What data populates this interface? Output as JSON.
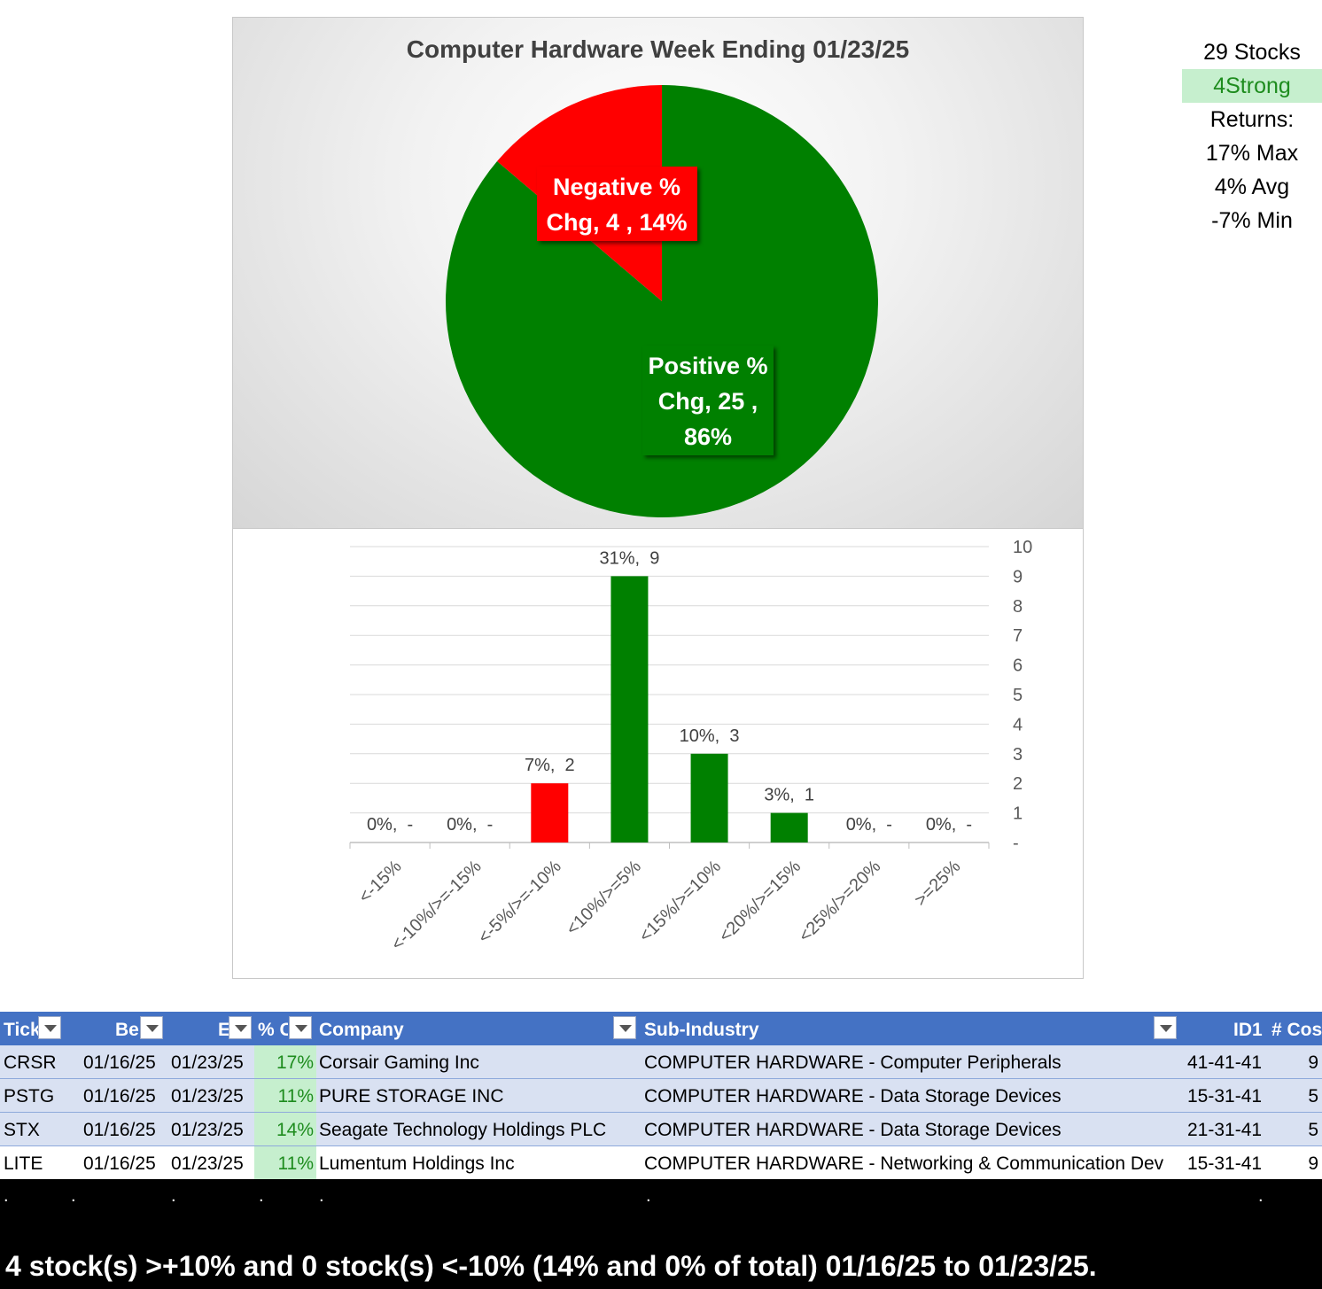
{
  "chart_data": [
    {
      "type": "pie",
      "title": "Computer Hardware Week Ending 01/23/25",
      "slices": [
        {
          "name": "Positive % Chg",
          "value": 25,
          "percent": 86,
          "color": "#008000"
        },
        {
          "name": "Negative % Chg",
          "value": 4,
          "percent": 14,
          "color": "#ff0000"
        }
      ],
      "labels": {
        "negative": [
          "Negative %",
          "Chg,  4 , 14%"
        ],
        "positive": [
          "Positive %",
          "Chg,  25 ,",
          "86%"
        ]
      }
    },
    {
      "type": "bar",
      "categories": [
        "<-15%",
        "<-10%/>=-15%",
        "<-5%/>=-10%",
        "<10%/>=5%",
        "<15%/>=10%",
        "<20%/>=15%",
        "<25%/>=20%",
        ">=25%"
      ],
      "values": [
        0,
        0,
        2,
        9,
        3,
        1,
        0,
        0
      ],
      "colors": [
        "#ff0000",
        "#ff0000",
        "#ff0000",
        "#008000",
        "#008000",
        "#008000",
        "#008000",
        "#008000"
      ],
      "data_labels": [
        "0%,  -",
        "0%,  -",
        "7%,  2",
        "31%,  9",
        "10%,  3",
        "3%,  1",
        "0%,  -",
        "0%,  -"
      ],
      "ylim": [
        0,
        10
      ],
      "y_ticks": [
        "-",
        "1",
        "2",
        "3",
        "4",
        "5",
        "6",
        "7",
        "8",
        "9",
        "10"
      ],
      "y_axis_side": "right",
      "grid": true
    }
  ],
  "summary": {
    "stocks": "29 Stocks",
    "strong": "4Strong",
    "returns": "Returns:",
    "max": "17% Max",
    "avg": "4% Avg",
    "min": "-7% Min"
  },
  "table": {
    "headers": {
      "ticker": "Tick",
      "begin": "Be",
      "end": "E",
      "pct": "% C",
      "company": "Company",
      "subindustry": "Sub-Industry",
      "id1": "ID1",
      "cos": "# Cos"
    },
    "rows": [
      {
        "ticker": "CRSR",
        "begin": "01/16/25",
        "end": "01/23/25",
        "pct": "17%",
        "company": "Corsair Gaming Inc",
        "subindustry": "COMPUTER HARDWARE - Computer Peripherals",
        "id1": "41-41-41",
        "cos": "9"
      },
      {
        "ticker": "PSTG",
        "begin": "01/16/25",
        "end": "01/23/25",
        "pct": "11%",
        "company": "PURE STORAGE INC",
        "subindustry": "COMPUTER HARDWARE - Data Storage Devices",
        "id1": "15-31-41",
        "cos": "5"
      },
      {
        "ticker": "STX",
        "begin": "01/16/25",
        "end": "01/23/25",
        "pct": "14%",
        "company": "Seagate Technology Holdings PLC",
        "subindustry": "COMPUTER HARDWARE - Data Storage Devices",
        "id1": "21-31-41",
        "cos": "5"
      },
      {
        "ticker": "LITE",
        "begin": "01/16/25",
        "end": "01/23/25",
        "pct": "11%",
        "company": "Lumentum Holdings Inc",
        "subindustry": "COMPUTER HARDWARE - Networking & Communication Dev",
        "id1": "15-31-41",
        "cos": "9"
      }
    ]
  },
  "footer": {
    "dots": [
      ".",
      ".",
      ".",
      ".",
      ".",
      ".",
      "."
    ],
    "text": "4 stock(s) >+10% and 0 stock(s) <-10% (14% and 0% of total) 01/16/25 to 01/23/25."
  }
}
